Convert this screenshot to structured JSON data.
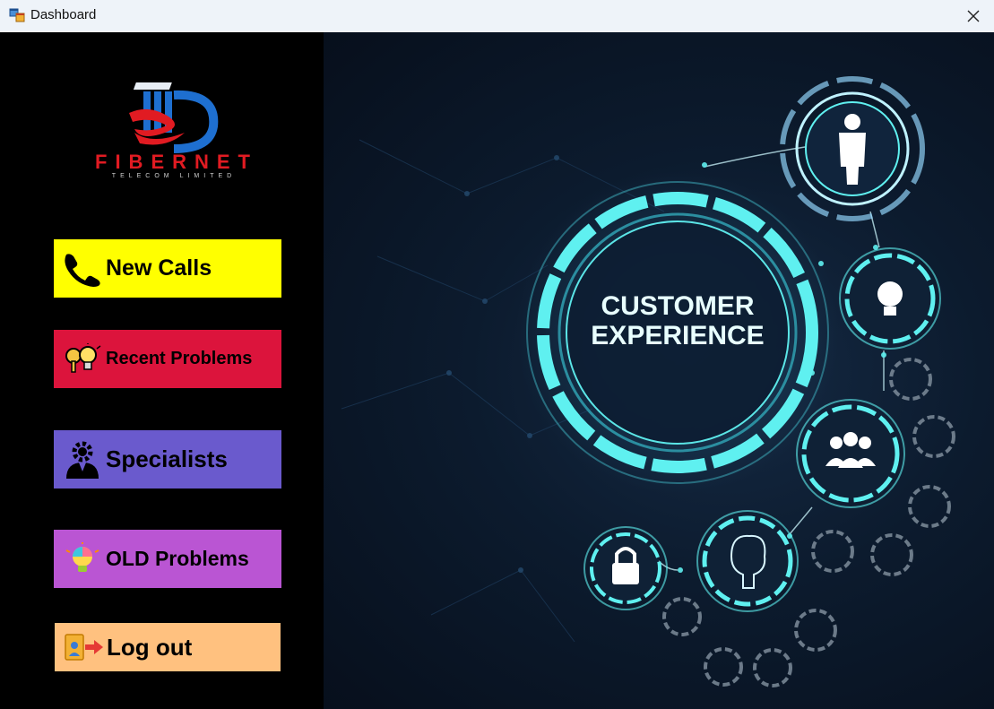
{
  "window": {
    "title": "Dashboard",
    "app_icon": "forms-window-icon",
    "close_icon": "close-icon"
  },
  "logo": {
    "brand": "FIBERNET",
    "tagline": "TELECOM LIMITED"
  },
  "menu": {
    "new_calls": {
      "label": "New Calls",
      "icon": "phone-icon",
      "color": "#ffff00"
    },
    "recent_problems": {
      "label": "Recent Problems",
      "icon": "keys-bulb-icon",
      "color": "#dc143c"
    },
    "specialists": {
      "label": "Specialists",
      "icon": "specialist-gear-icon",
      "color": "#6a5acd"
    },
    "old_problems": {
      "label": "OLD Problems",
      "icon": "idea-bulb-icon",
      "color": "#ba55d3"
    },
    "logout": {
      "label": "Log out",
      "icon": "logout-icon",
      "color": "#ffc17f"
    }
  },
  "hero": {
    "line1": "CUSTOMER",
    "line2": "EXPERIENCE"
  },
  "colors": {
    "sidebar": "#000000",
    "accent_cyan": "#5ff0f0",
    "hero_bg": "#0c1b2e"
  }
}
